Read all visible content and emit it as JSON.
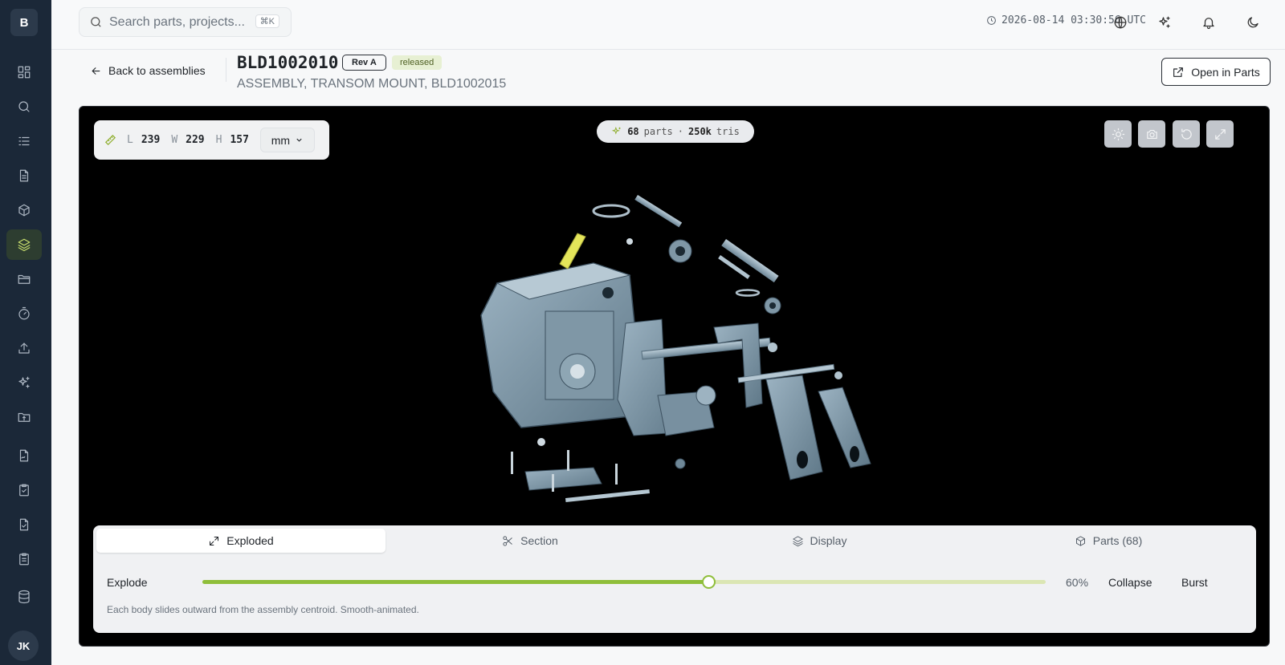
{
  "sidebar": {
    "logo": "B",
    "items": [
      {
        "name": "dashboard-icon"
      },
      {
        "name": "search-icon"
      },
      {
        "name": "list-icon"
      },
      {
        "name": "document-icon"
      },
      {
        "name": "cube-icon"
      },
      {
        "name": "layers-icon",
        "active": true
      },
      {
        "name": "folder-icon"
      },
      {
        "name": "timer-icon"
      },
      {
        "name": "upload-icon"
      },
      {
        "name": "sparkles-icon"
      },
      {
        "name": "folder-import-icon"
      },
      {
        "name": "file-signature-icon"
      },
      {
        "name": "clipboard-check-icon"
      },
      {
        "name": "file-check-icon"
      },
      {
        "name": "clipboard-list-icon"
      },
      {
        "name": "database-icon"
      }
    ],
    "avatar": "JK",
    "active_color": "#c8de6e"
  },
  "topbar": {
    "search_placeholder": "Search parts, projects...",
    "shortcut": "⌘K",
    "timestamp": "2026-08-14 03:30:56 UTC",
    "icons": [
      "globe-icon",
      "sparkles-icon",
      "bell-icon",
      "moon-icon"
    ]
  },
  "header": {
    "back_label": "Back to assemblies",
    "assembly_id": "BLD1002010",
    "revision": "Rev A",
    "status": "released",
    "description": "ASSEMBLY, TRANSOM MOUNT, BLD1002015",
    "open_button": "Open in Parts"
  },
  "viewer": {
    "dims": {
      "l_label": "L",
      "l": "239",
      "w_label": "W",
      "w": "229",
      "h_label": "H",
      "h": "157",
      "unit": "mm"
    },
    "stats": {
      "parts": "68",
      "parts_label": "parts",
      "sep": "·",
      "tris": "250k",
      "tris_label": "tris"
    },
    "toolbar": [
      "sun-icon",
      "camera-icon",
      "reset-icon",
      "fullscreen-icon"
    ],
    "accent": "#8fbe3a"
  },
  "panel": {
    "tabs": [
      {
        "label": "Exploded",
        "icon": "exploded-icon",
        "active": true
      },
      {
        "label": "Section",
        "icon": "scissors-icon"
      },
      {
        "label": "Display",
        "icon": "layers-icon"
      },
      {
        "label": "Parts (68)",
        "icon": "box-icon"
      }
    ],
    "explode_label": "Explode",
    "explode_percent": 60,
    "explode_value": "60%",
    "collapse": "Collapse",
    "burst": "Burst",
    "hint": "Each body slides outward from the assembly centroid. Smooth-animated."
  }
}
